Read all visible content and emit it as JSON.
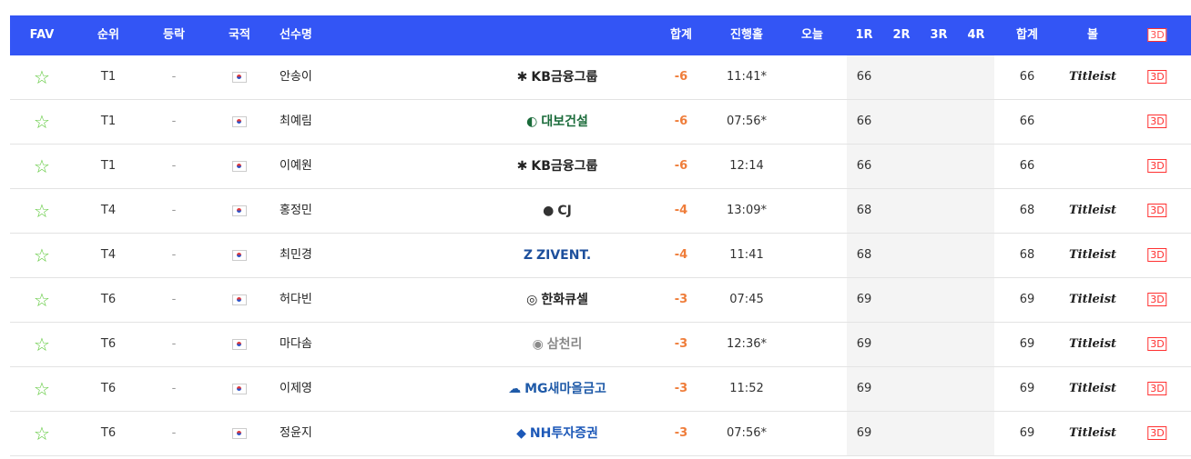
{
  "header": {
    "fav": "FAV",
    "rank": "순위",
    "change": "등락",
    "nation": "국적",
    "player": "선수명",
    "total": "합계",
    "hole": "진행홀",
    "today": "오늘",
    "r1": "1R",
    "r2": "2R",
    "r3": "3R",
    "r4": "4R",
    "total2": "합계",
    "ball": "볼",
    "td": "3D"
  },
  "colors": {
    "header_bg": "#3355f5",
    "score": "#ef7d3a",
    "star": "#5fc93c",
    "badge": "#ff3030"
  },
  "rows": [
    {
      "rank": "T1",
      "change": "-",
      "name": "안송이",
      "sponsor": "KB금융그룹",
      "sponsor_mark": "✱",
      "total": "-6",
      "hole": "11:41*",
      "r1": "66",
      "sum": "66",
      "ball": "Titleist",
      "td": "3D"
    },
    {
      "rank": "T1",
      "change": "-",
      "name": "최예림",
      "sponsor": "대보건설",
      "sponsor_mark": "◐",
      "total": "-6",
      "hole": "07:56*",
      "r1": "66",
      "sum": "66",
      "ball": "",
      "td": "3D"
    },
    {
      "rank": "T1",
      "change": "-",
      "name": "이예원",
      "sponsor": "KB금융그룹",
      "sponsor_mark": "✱",
      "total": "-6",
      "hole": "12:14",
      "r1": "66",
      "sum": "66",
      "ball": "",
      "td": "3D"
    },
    {
      "rank": "T4",
      "change": "-",
      "name": "홍정민",
      "sponsor": "CJ",
      "sponsor_mark": "●",
      "total": "-4",
      "hole": "13:09*",
      "r1": "68",
      "sum": "68",
      "ball": "Titleist",
      "td": "3D"
    },
    {
      "rank": "T4",
      "change": "-",
      "name": "최민경",
      "sponsor": "ZIVENT.",
      "sponsor_mark": "Z",
      "total": "-4",
      "hole": "11:41",
      "r1": "68",
      "sum": "68",
      "ball": "Titleist",
      "td": "3D"
    },
    {
      "rank": "T6",
      "change": "-",
      "name": "허다빈",
      "sponsor": "한화큐셀",
      "sponsor_mark": "◎",
      "total": "-3",
      "hole": "07:45",
      "r1": "69",
      "sum": "69",
      "ball": "Titleist",
      "td": "3D"
    },
    {
      "rank": "T6",
      "change": "-",
      "name": "마다솜",
      "sponsor": "삼천리",
      "sponsor_mark": "◉",
      "total": "-3",
      "hole": "12:36*",
      "r1": "69",
      "sum": "69",
      "ball": "Titleist",
      "td": "3D"
    },
    {
      "rank": "T6",
      "change": "-",
      "name": "이제영",
      "sponsor": "MG새마을금고",
      "sponsor_mark": "☁",
      "total": "-3",
      "hole": "11:52",
      "r1": "69",
      "sum": "69",
      "ball": "Titleist",
      "td": "3D"
    },
    {
      "rank": "T6",
      "change": "-",
      "name": "정윤지",
      "sponsor": "NH투자증권",
      "sponsor_mark": "◆",
      "total": "-3",
      "hole": "07:56*",
      "r1": "69",
      "sum": "69",
      "ball": "Titleist",
      "td": "3D"
    }
  ],
  "sponsor_colors": {
    "KB금융그룹": "#222222",
    "대보건설": "#1a6b3a",
    "CJ": "#333333",
    "ZIVENT.": "#1d4f9c",
    "한화큐셀": "#222222",
    "삼천리": "#8a8a8a",
    "MG새마을금고": "#1f5aa8",
    "NH투자증권": "#1c58b8"
  }
}
